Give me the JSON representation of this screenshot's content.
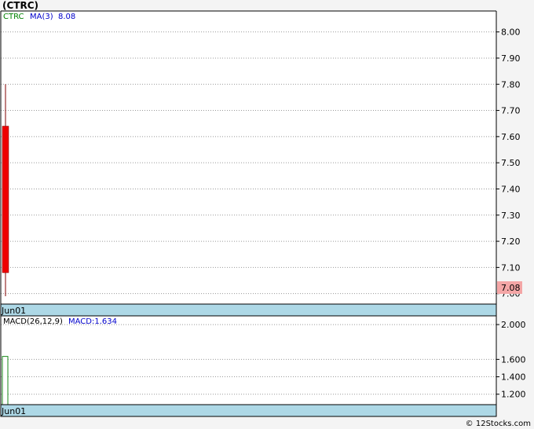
{
  "title": "(CTRC)",
  "footer": "© 12Stocks.com",
  "colors": {
    "down_candle": "#ee0000",
    "wick": "#800000",
    "macd_bar": "#1a8a1a",
    "date_strip": "#add8e6",
    "ticker_label": "#008000",
    "indicator_label": "#0000cc",
    "last_price_bg": "#f4a6a6"
  },
  "chart_data": [
    {
      "type": "candlestick",
      "legend": {
        "ticker": "CTRC",
        "ma_label": "MA(3)",
        "ma_value": "8.08"
      },
      "candles": [
        {
          "date": "Jun01",
          "open": 7.64,
          "high": 7.8,
          "low": 6.99,
          "close": 7.08
        }
      ],
      "last_price": "7.08",
      "ylim": [
        6.96,
        8.08
      ],
      "yticks": [
        "7.00",
        "7.10",
        "7.20",
        "7.30",
        "7.40",
        "7.50",
        "7.60",
        "7.70",
        "7.80",
        "7.90",
        "8.00"
      ],
      "x_labels": [
        "Jun01"
      ],
      "grid": true
    },
    {
      "type": "bar",
      "legend": {
        "name": "MACD(26,12,9)",
        "value_label": "MACD:1.634"
      },
      "values": [
        1.634
      ],
      "categories": [
        "Jun01"
      ],
      "ylim": [
        1.08,
        2.1
      ],
      "yticks": [
        "1.200",
        "1.400",
        "1.600",
        "2.000"
      ],
      "x_labels": [
        "Jun01"
      ],
      "grid": true
    }
  ]
}
